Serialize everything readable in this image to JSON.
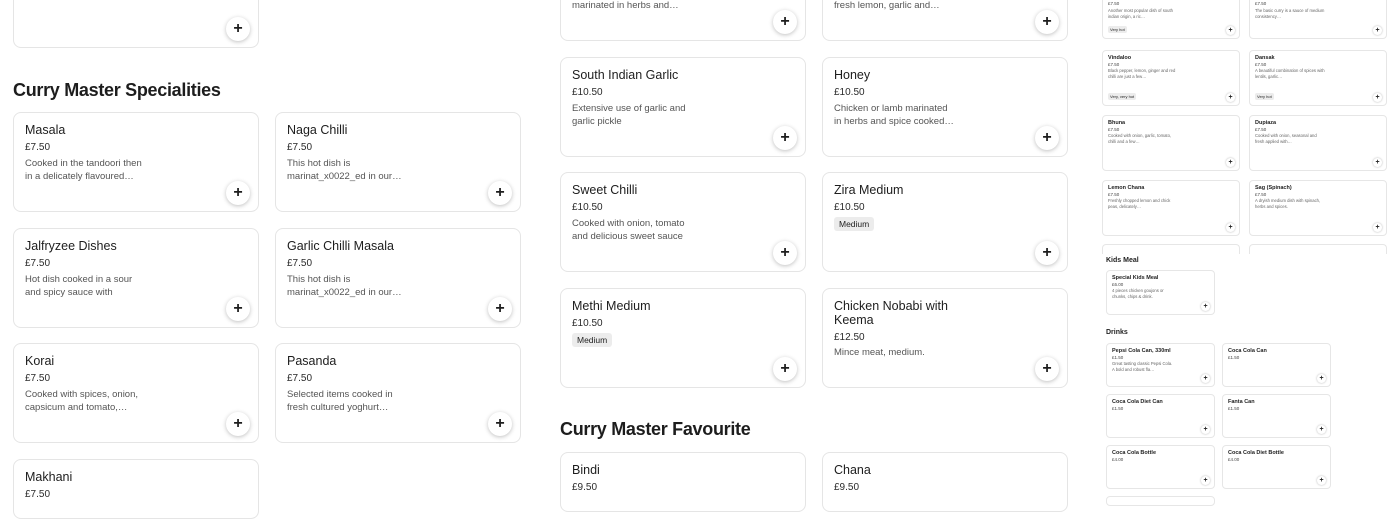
{
  "add_label": "+",
  "sections": {
    "specialities": "Curry Master Specialities",
    "favourite": "Curry Master Favourite"
  },
  "col1": [
    {
      "name": "Masala",
      "price": "£7.50",
      "desc": "Cooked in the tandoori then in a delicately flavoured…"
    },
    {
      "name": "Jalfryzee Dishes",
      "price": "£7.50",
      "desc": "Hot dish cooked in a sour and spicy sauce with green…"
    },
    {
      "name": "Korai",
      "price": "£7.50",
      "desc": "Cooked with spices, onion, capsicum and tomato,…"
    },
    {
      "name": "Makhani",
      "price": "£7.50",
      "desc": ""
    }
  ],
  "col2": [
    {
      "name": "Naga Chilli",
      "price": "£7.50",
      "desc": "This hot dish is marinat_x0022_ed in our…"
    },
    {
      "name": "Garlic Chilli Masala",
      "price": "£7.50",
      "desc": "This hot dish is marinat_x0022_ed in our…"
    },
    {
      "name": "Pasanda",
      "price": "£7.50",
      "desc": "Selected items cooked in fresh cultured yoghurt…"
    }
  ],
  "col3": [
    {
      "desc": "marinated in herbs and…"
    },
    {
      "name": "South Indian Garlic",
      "price": "£10.50",
      "desc": "Extensive use of garlic and garlic pickle"
    },
    {
      "name": "Sweet Chilli",
      "price": "£10.50",
      "desc": "Cooked with onion, tomato and delicious sweet sauce"
    },
    {
      "name": "Methi Medium",
      "price": "£10.50",
      "badge": "Medium"
    }
  ],
  "col4": [
    {
      "desc": "fresh lemon, garlic and…"
    },
    {
      "name": "Honey",
      "price": "£10.50",
      "desc": "Chicken or lamb marinated in herbs and spice cooked…"
    },
    {
      "name": "Zira Medium",
      "price": "£10.50",
      "badge": "Medium"
    },
    {
      "name": "Chicken Nobabi with Keema",
      "price": "£12.50",
      "desc": "Mince meat, medium."
    }
  ],
  "favourite": [
    {
      "name": "Bindi",
      "price": "£9.50"
    },
    {
      "name": "Chana",
      "price": "£9.50"
    }
  ],
  "mini": {
    "top_left": {
      "price": "£7.50",
      "desc": "Another most popular dish of south indian origin, a ric…",
      "badge": "Very hot"
    },
    "top_right": {
      "price": "£7.50",
      "desc": "The basic curry is a sauce of medium consistency…"
    },
    "rows": [
      [
        {
          "name": "Vindaloo",
          "price": "£7.50",
          "desc": "Black pepper, lemon, ginger and red chilli are just a few…",
          "badge": "Very, very hot"
        },
        {
          "name": "Dansak",
          "price": "£7.50",
          "desc": "A beautiful combination of spices with lentils, garlic…",
          "badge": "Very hot"
        }
      ],
      [
        {
          "name": "Bhuna",
          "price": "£7.50",
          "desc": "Cooked with onion, garlic, tomato, chilli and a few…"
        },
        {
          "name": "Dupiaza",
          "price": "£7.50",
          "desc": "Cooked with onion, seasonal and fresh applied with…"
        }
      ],
      [
        {
          "name": "Lemon Chana",
          "price": "£7.50",
          "desc": "Freshly chopped lemon and chick peas, delicately…"
        },
        {
          "name": "Sag (Spinach)",
          "price": "£7.50",
          "desc": "A dryish medium dish with spinach, herbs and spices."
        }
      ]
    ],
    "kids_title": "Kids Meal",
    "kids": {
      "name": "Special Kids Meal",
      "price": "£6.00",
      "desc": "4 pieces chicken goujons or chunks, chips & drink."
    },
    "drinks_title": "Drinks",
    "drinks": [
      {
        "name": "Pepsi Cola Can, 330ml",
        "price": "£1.50",
        "desc": "Great tasting classic Pepsi Cola. A bold and robust fla…"
      },
      {
        "name": "Coca Cola Can",
        "price": "£1.50",
        "desc": ""
      },
      {
        "name": "Coca Cola Diet Can",
        "price": "£1.50",
        "desc": ""
      },
      {
        "name": "Fanta Can",
        "price": "£1.50",
        "desc": ""
      },
      {
        "name": "Coca Cola Bottle",
        "price": "£4.00",
        "desc": ""
      },
      {
        "name": "Coca Cola Diet Bottle",
        "price": "£4.00",
        "desc": ""
      }
    ]
  }
}
